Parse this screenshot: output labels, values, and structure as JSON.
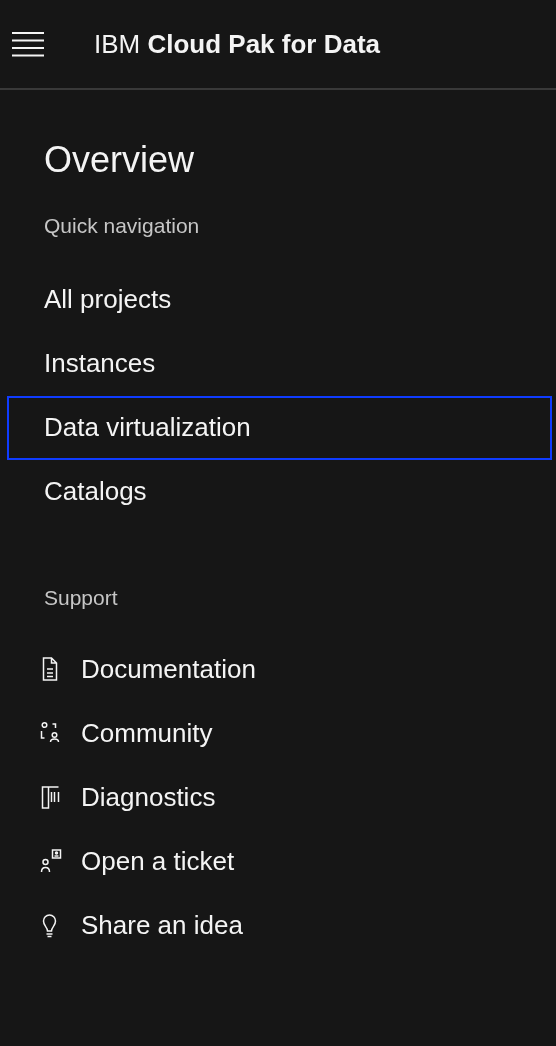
{
  "header": {
    "title": "IBM **Cloud Pak for Data**"
  },
  "page_title": "Overview",
  "quick_navigation": {
    "heading": "Quick navigation",
    "items": [
      {
        "label": "All projects",
        "focused": false
      },
      {
        "label": "Instances",
        "focused": false
      },
      {
        "label": "Data virtualization",
        "focused": true
      },
      {
        "label": "Catalogs",
        "focused": false
      }
    ]
  },
  "support": {
    "heading": "Support",
    "items": [
      {
        "label": "Documentation",
        "kind": "document"
      },
      {
        "label": "Community",
        "kind": "community"
      },
      {
        "label": "Diagnostics",
        "kind": "diagnostics"
      },
      {
        "label": "Open a ticket",
        "kind": "ticket"
      },
      {
        "label": "Share an idea",
        "kind": "idea"
      }
    ]
  }
}
